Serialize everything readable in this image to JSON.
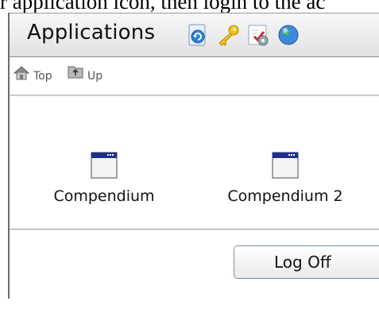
{
  "instruction_text": "r application icon, then login to the ac",
  "header": {
    "title": "Applications",
    "icons": [
      "refresh-icon",
      "key-icon",
      "settings-icon",
      "help-icon"
    ]
  },
  "nav": {
    "top_label": "Top",
    "up_label": "Up"
  },
  "apps": [
    {
      "label": "Compendium",
      "icon": "application-window-icon"
    },
    {
      "label": "Compendium 2",
      "icon": "application-window-icon"
    }
  ],
  "footer": {
    "logoff_label": "Log Off"
  },
  "colors": {
    "window_titlebar": "#1f2f8c",
    "border": "#6b6b6b"
  }
}
